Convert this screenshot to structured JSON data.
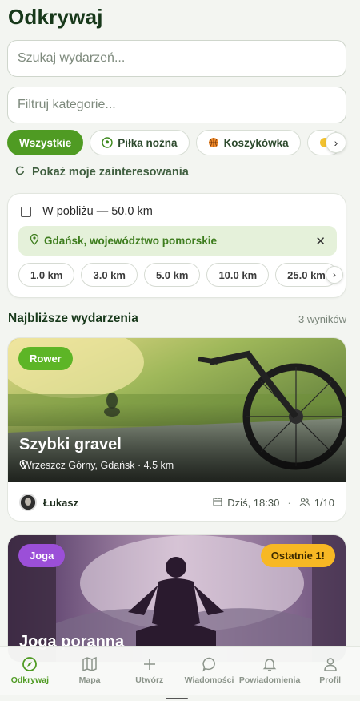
{
  "header": {
    "title": "Odkrywaj"
  },
  "search": {
    "placeholder": "Szukaj wydarzeń..."
  },
  "filter": {
    "placeholder": "Filtruj kategorie..."
  },
  "categories": [
    {
      "label": "Wszystkie",
      "icon": "",
      "active": true
    },
    {
      "label": "Piłka nożna",
      "icon": "soccer-ball-icon",
      "active": false
    },
    {
      "label": "Koszykówka",
      "icon": "basketball-icon",
      "active": false
    }
  ],
  "interests": {
    "label": "Pokaż moje zainteresowania",
    "icon": "refresh-icon"
  },
  "nearby": {
    "label": "W pobliżu — 50.0 km",
    "location": "Gdańsk, województwo pomorskie",
    "distances": [
      "1.0 km",
      "3.0 km",
      "5.0 km",
      "10.0 km",
      "25.0 km"
    ]
  },
  "events_section": {
    "title": "Najbliższe wydarzenia",
    "count": "3 wyników"
  },
  "events": [
    {
      "tag": "Rower",
      "title": "Szybki gravel",
      "location": "Wrzeszcz Górny, Gdańsk · 4.5 km",
      "host": "Łukasz",
      "datetime": "Dziś, 18:30",
      "participants": "1/10"
    },
    {
      "tag": "Joga",
      "badge": "Ostatnie 1!",
      "title": "Joga poranna"
    }
  ],
  "tabbar": [
    {
      "label": "Odkrywaj",
      "icon": "compass-icon",
      "active": true
    },
    {
      "label": "Mapa",
      "icon": "map-icon",
      "active": false
    },
    {
      "label": "Utwórz",
      "icon": "plus-icon",
      "active": false
    },
    {
      "label": "Wiadomości",
      "icon": "chat-icon",
      "active": false
    },
    {
      "label": "Powiadomienia",
      "icon": "bell-icon",
      "active": false
    },
    {
      "label": "Profil",
      "icon": "user-icon",
      "active": false
    }
  ],
  "colors": {
    "accent": "#4f9b23",
    "dark": "#17381a",
    "bike_tag": "#5db526",
    "yoga_tag": "#9b4fd8",
    "badge": "#f7b824"
  }
}
